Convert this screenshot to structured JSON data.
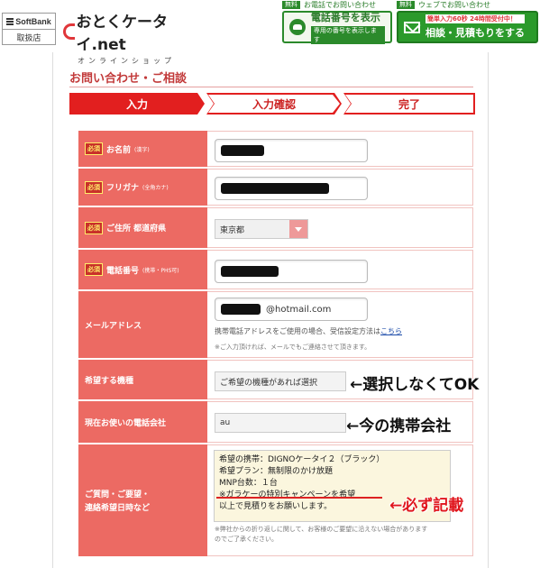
{
  "header": {
    "softbank_top": "SoftBank",
    "softbank_bottom": "取扱店",
    "logo_main": "おとくケータイ.net",
    "logo_sub": "オンラインショップ",
    "phone_free": "無料",
    "phone_tag": "お電話でお問い合わせ",
    "phone_title": "電話番号を表示",
    "phone_sub": "専用の番号を表示します",
    "web_free": "無料",
    "web_tag": "ウェブでお問い合わせ",
    "web_badge": "簡単入力60秒 24時間受付中！",
    "web_title": "相談・見積もりをする"
  },
  "page": {
    "title": "お問い合わせ・ご相談"
  },
  "steps": [
    "入力",
    "入力確認",
    "完了"
  ],
  "form": {
    "required_label": "必須",
    "name_label": "お名前",
    "name_sub": "(漢字)",
    "kana_label": "フリガナ",
    "kana_sub": "(全角カナ)",
    "address_label": "ご住所 都道府県",
    "address_value": "東京都",
    "phone_label": "電話番号",
    "phone_sub": "(携帯・PHS可)",
    "email_label": "メールアドレス",
    "email_value": "@hotmail.com",
    "email_note": "携帯電話アドレスをご使用の場合、受信設定方法は",
    "email_note_link": "こちら",
    "email_note2": "※ご入力頂ければ、メールでもご連絡させて頂きます。",
    "model_label": "希望する機種",
    "model_value": "ご希望の機種があれば選択",
    "carrier_label": "現在お使いの電話会社",
    "carrier_value": "au",
    "question_label_1": "ご質問・ご要望・",
    "question_label_2": "連絡希望日時など",
    "question_lines": [
      "希望の携帯：DIGNOケータイ２（ブラック）",
      "希望プラン：無制限のかけ放題",
      "MNP台数：１台",
      "※ガラケーの特別キャンペーンを希望",
      "以上で見積りをお願いします。"
    ],
    "question_note_1": "※弊社からの折り返しに関して、お客様のご要望に沿えない場合があります",
    "question_note_2": "のでご了承ください。"
  },
  "annotations": {
    "model": "←選択しなくてOK",
    "carrier": "←今の携帯会社",
    "question": "←必ず記載"
  },
  "colors": {
    "accent_red": "#e21f1f",
    "label_bg": "#ec6a63",
    "green": "#2b8a2b"
  }
}
